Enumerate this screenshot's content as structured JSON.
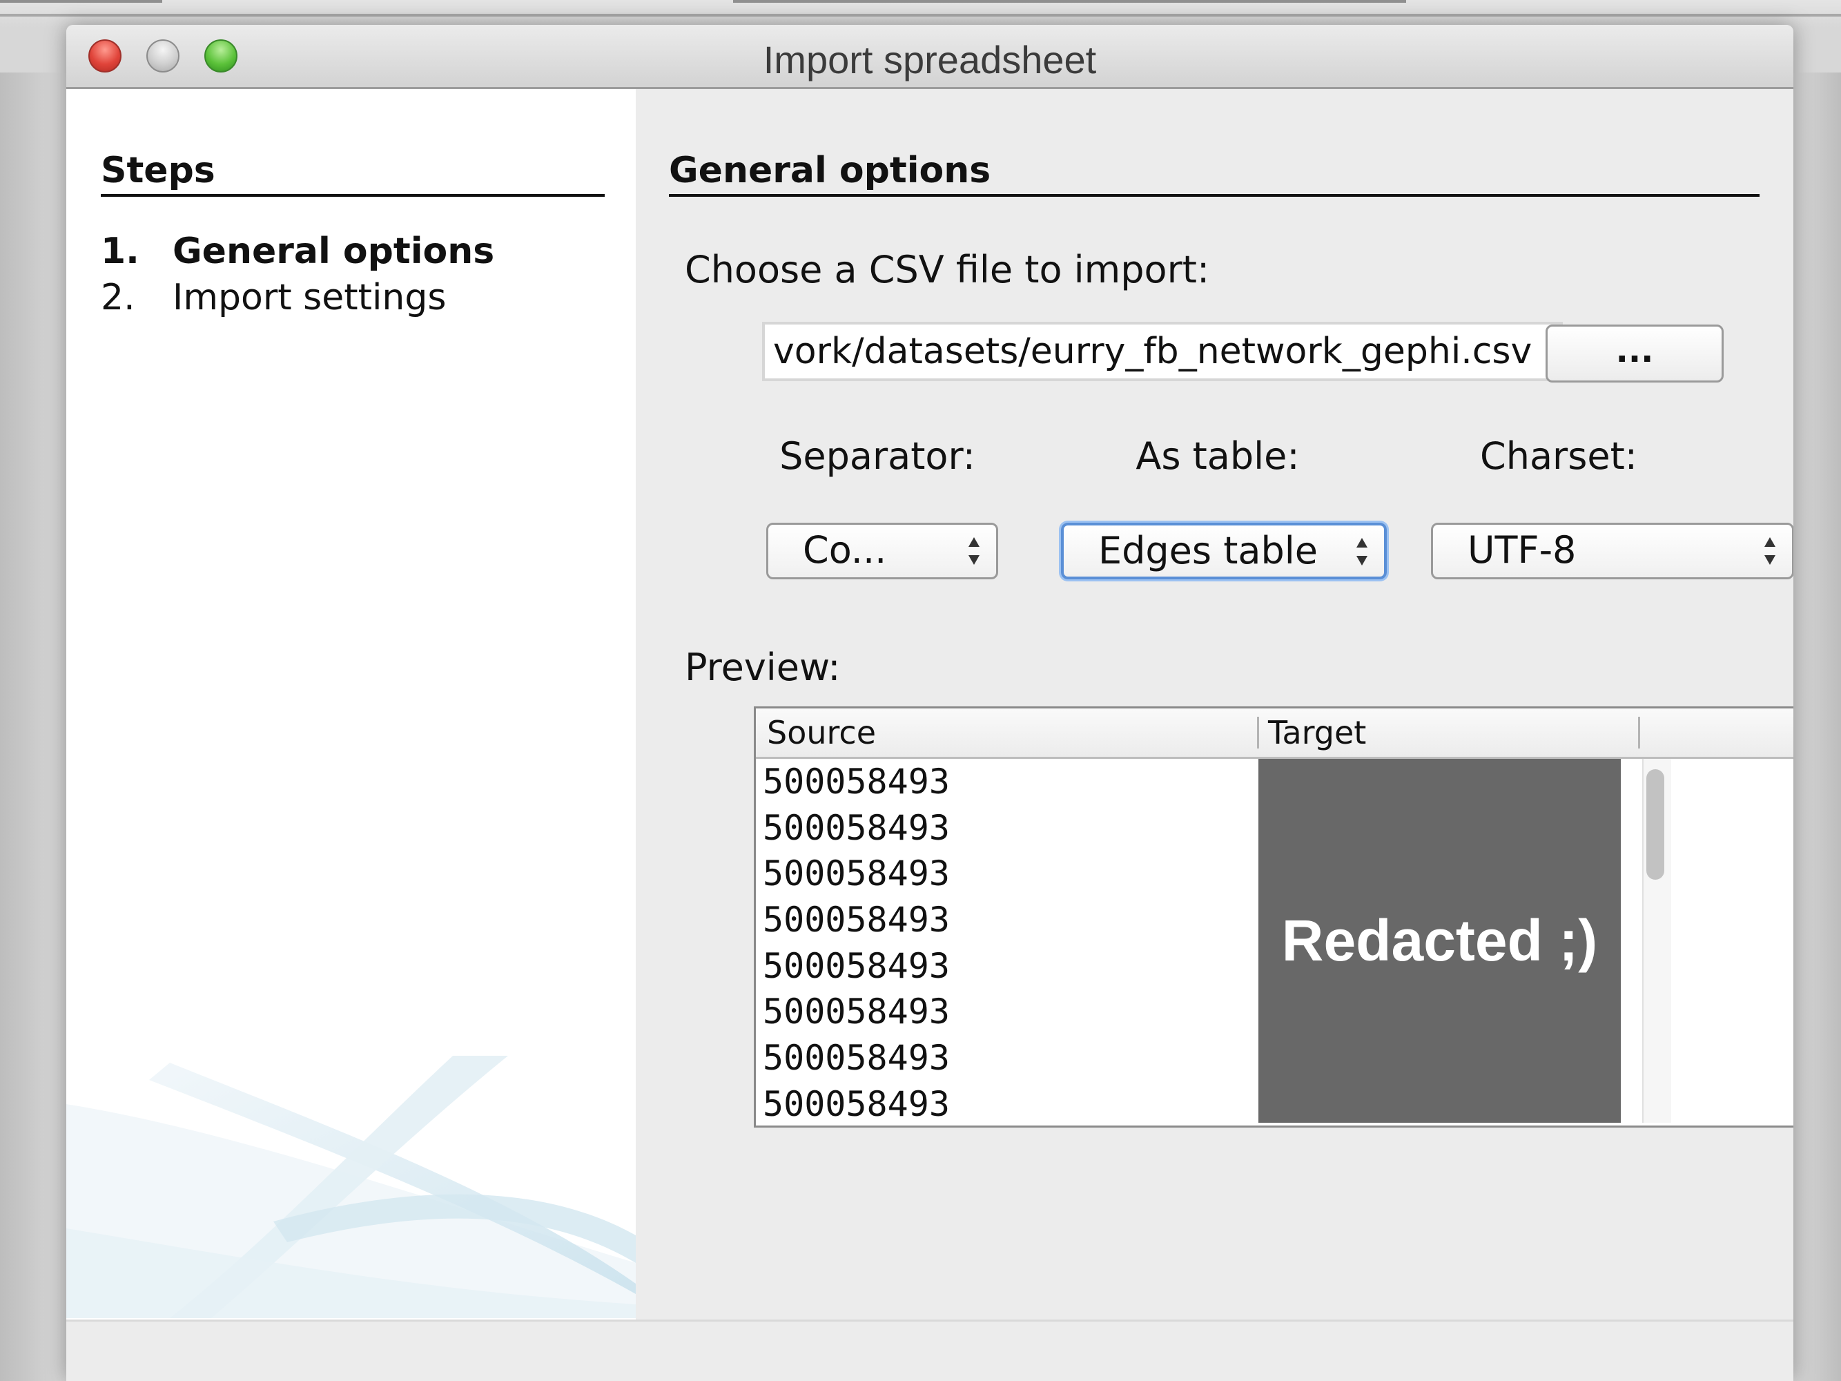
{
  "window": {
    "title": "Import spreadsheet"
  },
  "steps_panel": {
    "heading": "Steps",
    "items": [
      {
        "number": "1.",
        "label": "General options",
        "active": true
      },
      {
        "number": "2.",
        "label": "Import settings",
        "active": false
      }
    ]
  },
  "general_options": {
    "heading": "General options",
    "file_label": "Choose a CSV file to import:",
    "file_path": "vork/datasets/eurry_fb_network_gephi.csv",
    "browse_label": "...",
    "separator": {
      "label": "Separator:",
      "value": "Co..."
    },
    "as_table": {
      "label": "As table:",
      "value": "Edges table"
    },
    "charset": {
      "label": "Charset:",
      "value": "UTF-8"
    }
  },
  "preview": {
    "label": "Preview:",
    "columns": [
      "Source",
      "Target"
    ],
    "rows": [
      "500058493",
      "500058493",
      "500058493",
      "500058493",
      "500058493",
      "500058493",
      "500058493",
      "500058493"
    ],
    "redacted_text": "Redacted ;)"
  },
  "icons": {
    "close": "close-icon",
    "minimize": "minimize-icon",
    "zoom": "zoom-icon",
    "select_arrows": "up-down-arrows-icon"
  },
  "colors": {
    "focus": "#5a8fd6",
    "redaction": "#686868",
    "close": "#e0443a",
    "zoom": "#5cc23a"
  }
}
